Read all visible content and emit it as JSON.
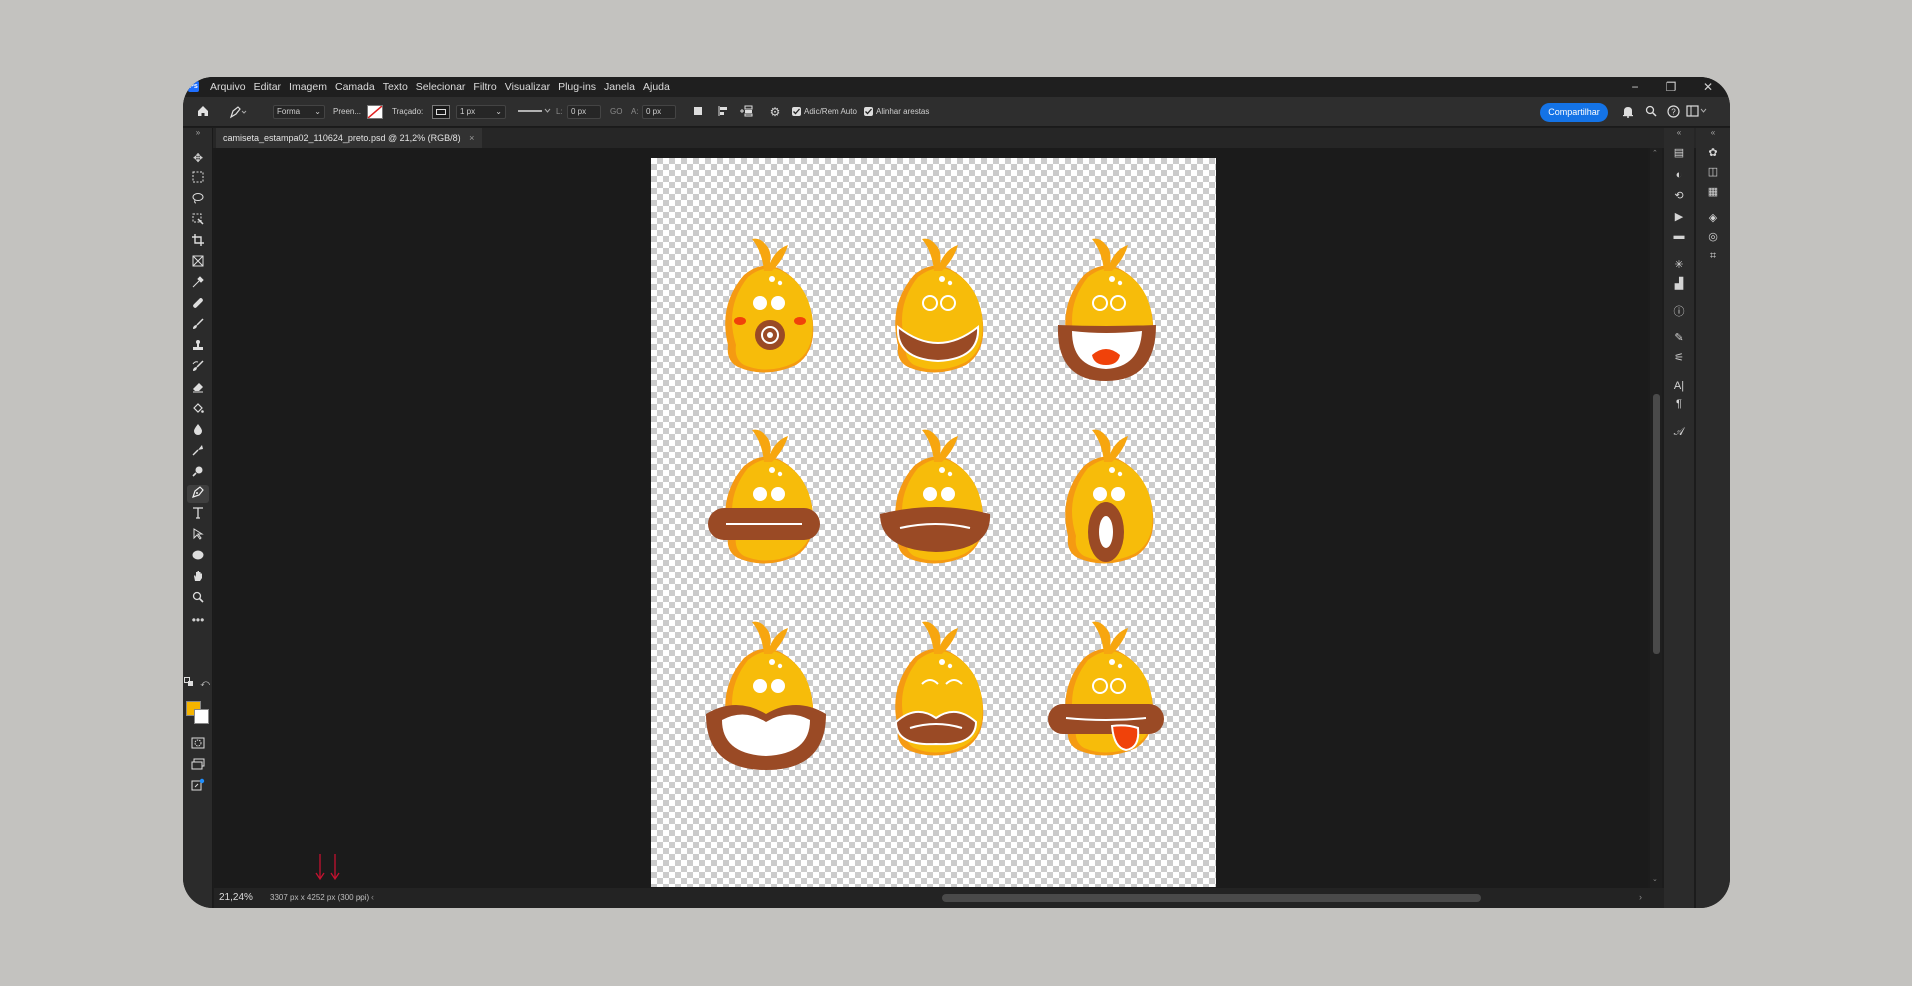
{
  "menubar": {
    "items": [
      "Arquivo",
      "Editar",
      "Imagem",
      "Camada",
      "Texto",
      "Selecionar",
      "Filtro",
      "Visualizar",
      "Plug-ins",
      "Janela",
      "Ajuda"
    ],
    "logo": "Ps",
    "minimize": "−",
    "restore": "❐",
    "close": "✕"
  },
  "options": {
    "home_icon": "home-icon",
    "tool_mode": "Forma",
    "fill_label": "Preen...",
    "stroke_label": "Traçado:",
    "stroke_width": "1 px",
    "width_label": "L:",
    "width_value": "0 px",
    "link_label": "GO",
    "height_label": "A:",
    "height_value": "0 px",
    "auto_add_delete": "Adic/Rem Auto",
    "align_edges": "Alinhar arestas",
    "share_label": "Compartilhar"
  },
  "document": {
    "tab_title": "camiseta_estampa02_110624_preto.psd @ 21,2% (RGB/8)",
    "tab_close": "×"
  },
  "status": {
    "zoom": "21,24%",
    "dimensions": "3307 px x 4252 px (300 ppi)"
  },
  "colors": {
    "foreground": "#f5b400",
    "background": "#ffffff",
    "accent": "#1473e6"
  },
  "annotation": {
    "arrows": "↓↓"
  }
}
